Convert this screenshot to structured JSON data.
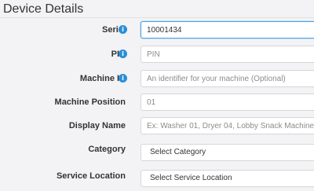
{
  "section_title": "Device Details",
  "fields": {
    "serial": {
      "label": "Serial",
      "value": "10001434",
      "info_icon": "info-icon"
    },
    "pin": {
      "label": "PIN",
      "placeholder": "PIN",
      "info_icon": "info-icon"
    },
    "machine_id": {
      "label": "Machine ID",
      "placeholder": "An identifier for your machine (Optional)",
      "info_icon": "info-icon"
    },
    "machine_position": {
      "label": "Machine Position",
      "placeholder": "01"
    },
    "display_name": {
      "label": "Display Name",
      "placeholder": "Ex: Washer 01, Dryer 04, Lobby Snack Machine"
    },
    "category": {
      "label": "Category",
      "selected": "Select Category"
    },
    "service_location": {
      "label": "Service Location",
      "selected": "Select Service Location"
    }
  },
  "colors": {
    "info_icon": "#2a8fd9",
    "focus_border": "#4da3e8"
  }
}
